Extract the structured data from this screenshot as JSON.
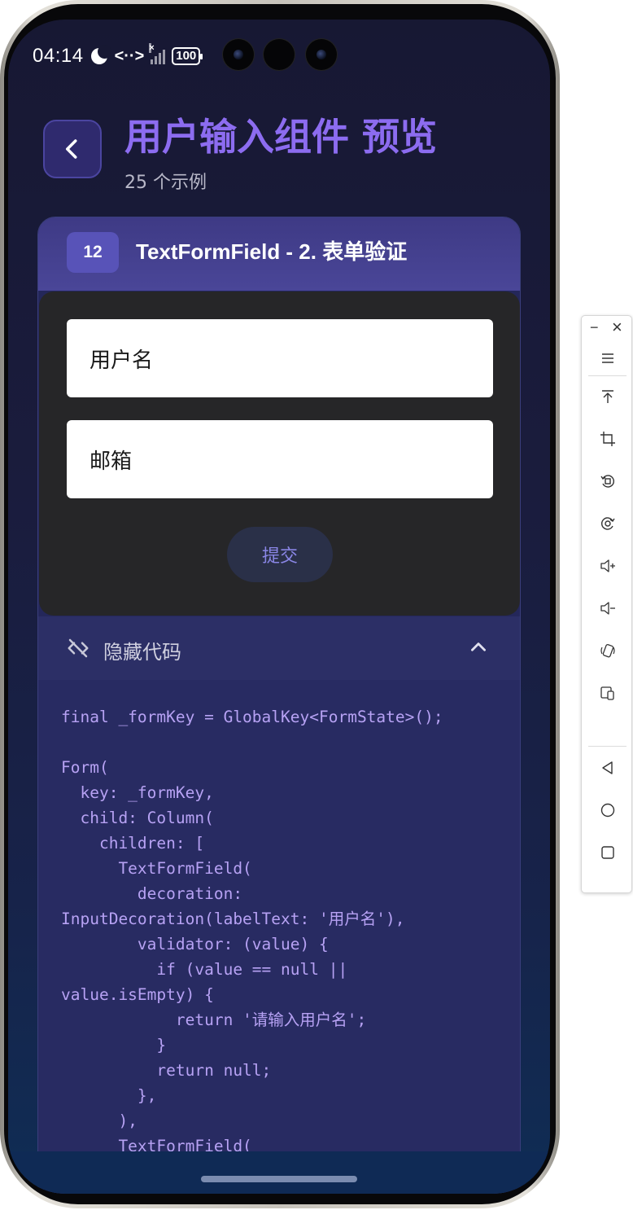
{
  "status_bar": {
    "time": "04:14",
    "data_indicator": "<··>",
    "signal_label": "×",
    "battery": "100"
  },
  "header": {
    "title": "用户输入组件 预览",
    "subtitle": "25 个示例"
  },
  "card": {
    "number": "12",
    "title": "TextFormField - 2. 表单验证",
    "fields": {
      "username_label": "用户名",
      "email_label": "邮箱"
    },
    "submit_label": "提交",
    "code_toggle_label": "隐藏代码",
    "code": "final _formKey = GlobalKey<FormState>();\n\nForm(\n  key: _formKey,\n  child: Column(\n    children: [\n      TextFormField(\n        decoration:\nInputDecoration(labelText: '用户名'),\n        validator: (value) {\n          if (value == null ||\nvalue.isEmpty) {\n            return '请输入用户名';\n          }\n          return null;\n        },\n      ),\n      TextFormField("
  },
  "toolbar": {
    "minimize": "−",
    "close": "×"
  },
  "colors": {
    "title_accent": "#8c6cf0",
    "code_text": "#b7a2f4",
    "submit_text": "#8a86e6"
  }
}
